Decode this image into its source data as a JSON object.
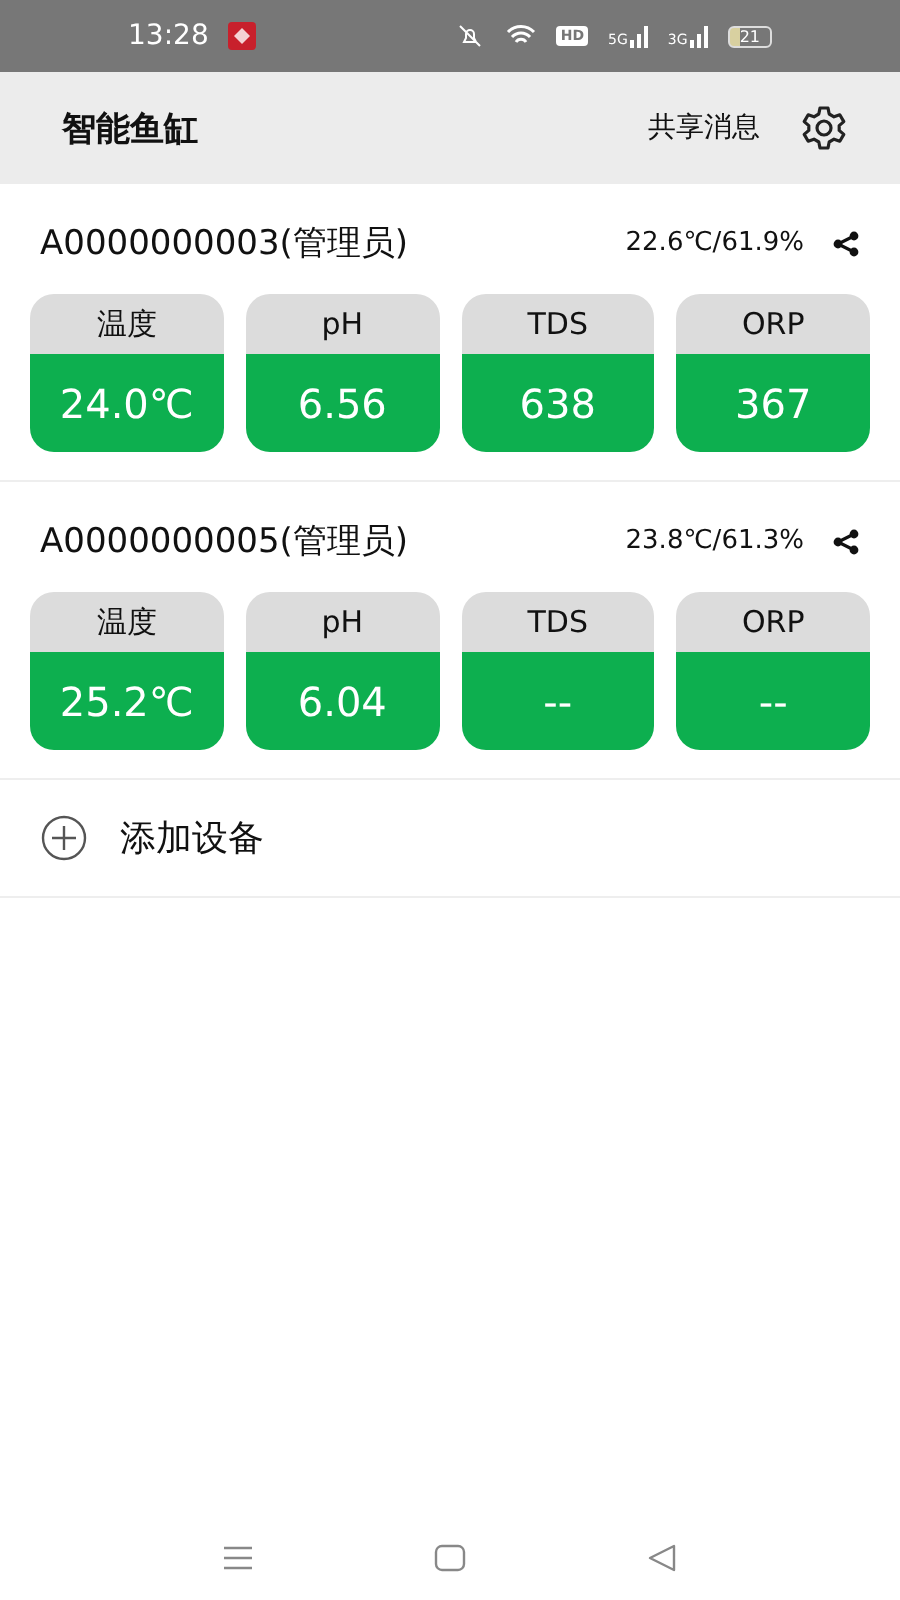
{
  "status_bar": {
    "time": "13:28",
    "hd": "HD",
    "networks": [
      "5G",
      "3G"
    ],
    "battery": "21"
  },
  "header": {
    "title": "智能鱼缸",
    "share_messages": "共享消息"
  },
  "devices": [
    {
      "name": "A0000000003(管理员)",
      "climate": "22.6℃/61.9%",
      "sensors": [
        {
          "label": "温度",
          "value": "24.0℃"
        },
        {
          "label": "pH",
          "value": "6.56"
        },
        {
          "label": "TDS",
          "value": "638"
        },
        {
          "label": "ORP",
          "value": "367"
        }
      ]
    },
    {
      "name": "A0000000005(管理员)",
      "climate": "23.8℃/61.3%",
      "sensors": [
        {
          "label": "温度",
          "value": "25.2℃"
        },
        {
          "label": "pH",
          "value": "6.04"
        },
        {
          "label": "TDS",
          "value": "--"
        },
        {
          "label": "ORP",
          "value": "--"
        }
      ]
    }
  ],
  "add_device": "添加设备"
}
